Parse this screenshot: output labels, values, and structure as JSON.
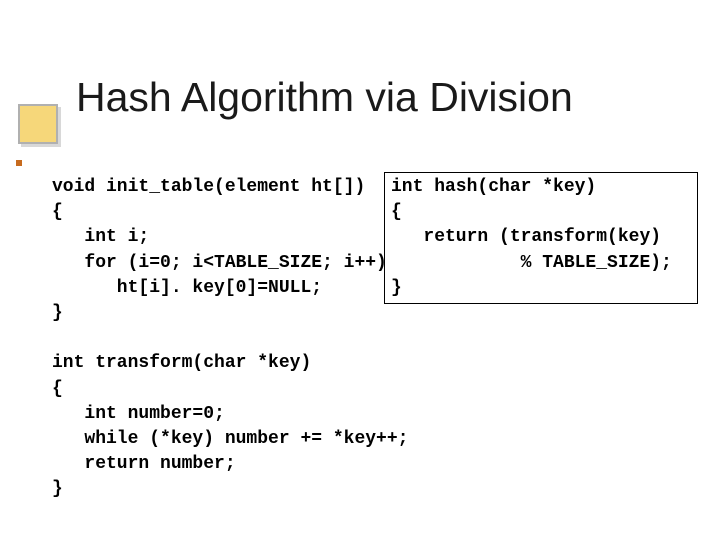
{
  "title": "Hash Algorithm via Division",
  "code_left": "void init_table(element ht[])\n{\n   int i;\n   for (i=0; i<TABLE_SIZE; i++)\n      ht[i]. key[0]=NULL;\n}\n\nint transform(char *key)\n{\n   int number=0;\n   while (*key) number += *key++;\n   return number;\n}",
  "code_right": "int hash(char *key)\n{\n   return (transform(key)\n            % TABLE_SIZE);\n}"
}
